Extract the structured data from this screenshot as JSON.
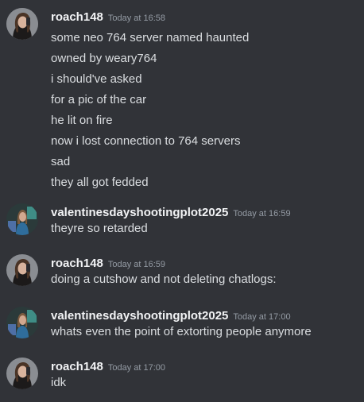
{
  "groups": [
    {
      "username": "roach148",
      "timestamp": "Today at 16:58",
      "avatar": "roach-avatar",
      "messages": [
        "some neo 764 server named haunted",
        "owned by weary764",
        "i should've asked",
        "for a pic of the car",
        "he lit on fire",
        "now i lost connection to 764 servers",
        "sad",
        "they all got fedded"
      ]
    },
    {
      "username": "valentinesdayshootingplot2025",
      "timestamp": "Today at 16:59",
      "avatar": "valentines-avatar",
      "messages": [
        "theyre so retarded"
      ]
    },
    {
      "username": "roach148",
      "timestamp": "Today at 16:59",
      "avatar": "roach-avatar",
      "messages": [
        "doing a cutshow and not deleting chatlogs:"
      ]
    },
    {
      "username": "valentinesdayshootingplot2025",
      "timestamp": "Today at 17:00",
      "avatar": "valentines-avatar",
      "messages": [
        "whats even the point of extorting people anymore"
      ]
    },
    {
      "username": "roach148",
      "timestamp": "Today at 17:00",
      "avatar": "roach-avatar",
      "messages": [
        "idk"
      ]
    }
  ],
  "colors": {
    "background": "#313338",
    "username": "#f2f3f5",
    "timestamp": "#949ba4",
    "message": "#dbdee1"
  }
}
